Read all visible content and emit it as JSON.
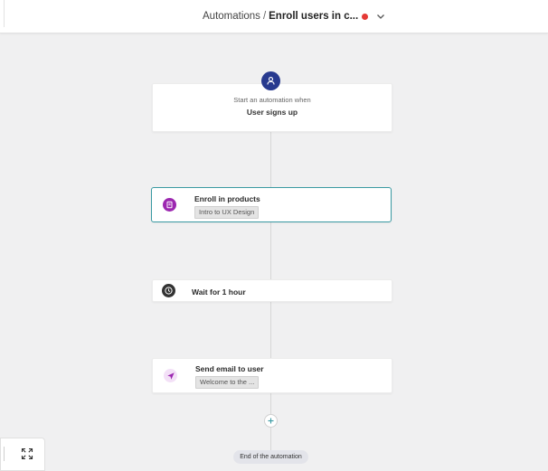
{
  "header": {
    "breadcrumb_root": "Automations",
    "separator": "/",
    "breadcrumb_current": "Enroll users in c...",
    "status_color": "#e53935"
  },
  "trigger": {
    "caption": "Start an automation when",
    "value": "User signs up",
    "icon": "user-icon"
  },
  "steps": [
    {
      "title": "Enroll in products",
      "chip": "Intro to UX Design",
      "icon": "product-icon",
      "icon_color": "#9c27b0"
    },
    {
      "title": "Wait for 1 hour",
      "icon": "clock-icon",
      "icon_color": "#333333"
    },
    {
      "title": "Send email to user",
      "chip": "Welcome to the ...",
      "icon": "send-icon",
      "icon_color": "#9c27b0"
    }
  ],
  "end_label": "End of the automation",
  "controls": {
    "add_icon": "plus-icon",
    "fullscreen_icon": "fullscreen-icon"
  }
}
